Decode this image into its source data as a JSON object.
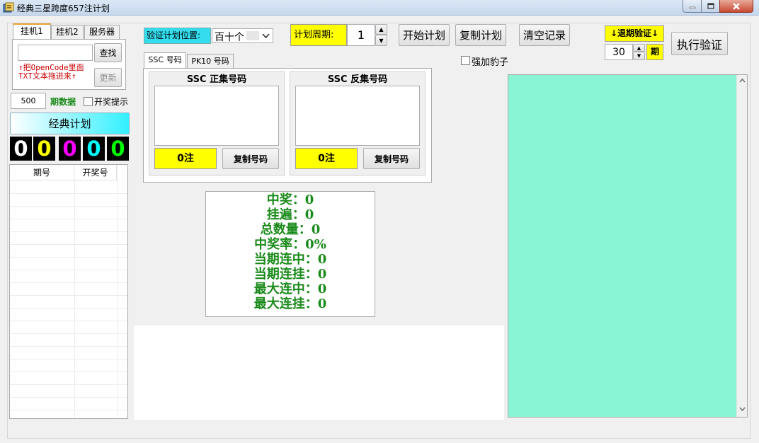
{
  "window": {
    "title": "经典三星跨度657注计划",
    "controls": {
      "minimize": "─",
      "maximize": "□",
      "close": "✕"
    }
  },
  "left_tabs": [
    "挂机1",
    "挂机2",
    "服务器"
  ],
  "left_panel": {
    "search_value": "",
    "find_button": "查找",
    "hint_line1": "↑把OpenCode里面",
    "hint_line2": "TXT文本拖进来↑",
    "update_button": "更新",
    "period_count": "500",
    "period_label": "期数据",
    "open_prompt_label": "开奖提示",
    "plan_button": "经典计划",
    "digits": [
      {
        "value": "0",
        "color": "#ffffff"
      },
      {
        "value": "0",
        "color": "#ffff00"
      },
      {
        "value": "0",
        "color": "#ff00ff"
      },
      {
        "value": "0",
        "color": "#00ffff"
      },
      {
        "value": "0",
        "color": "#00ff00"
      }
    ],
    "table_headers": [
      "期号",
      "开奖号"
    ]
  },
  "toolbar": {
    "position_label": "验证计划位置:",
    "position_value": "百十个",
    "cycle_label": "计划周期:",
    "cycle_value": "1",
    "start_button": "开始计划",
    "copy_plan_button": "复制计划",
    "clear_button": "清空记录",
    "reverse_label": "↓退期验证↓",
    "reverse_value": "30",
    "reverse_unit": "期",
    "verify_button": "执行验证",
    "leopard_label": "强加豹子"
  },
  "number_tabs": [
    "SSC 号码",
    "PK10 号码"
  ],
  "number_groups": {
    "forward_title": "SSC 正集号码",
    "forward_count": "0注",
    "forward_copy": "复制号码",
    "reverse_title": "SSC 反集号码",
    "reverse_count": "0注",
    "reverse_copy": "复制号码"
  },
  "stats": [
    "中奖：0",
    "挂遍：0",
    "总数量：0",
    "中奖率：0%",
    "当期连中：0",
    "当期连挂：0",
    "最大连中：0",
    "最大连挂：0"
  ],
  "colors": {
    "accent_yellow": "#ffff00",
    "cyan_label": "#33ddee",
    "result_bg": "#8af5d4",
    "stat_green": "#1a8a1a"
  }
}
